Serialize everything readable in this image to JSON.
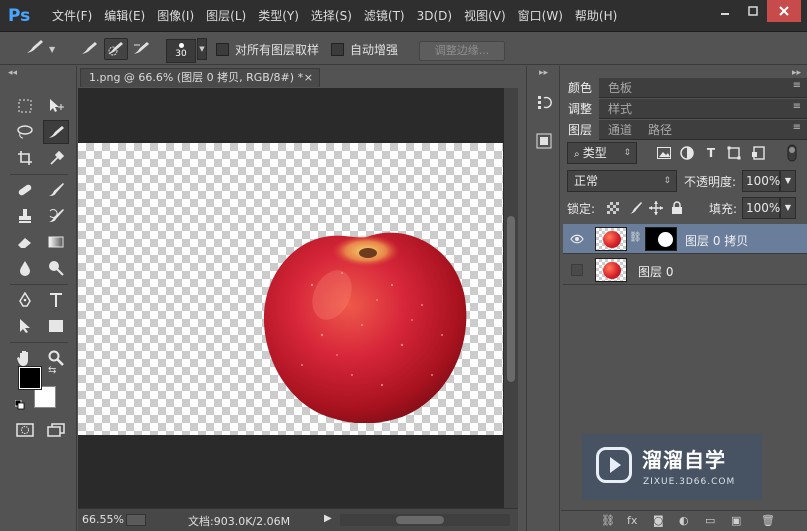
{
  "app": {
    "logo": "Ps",
    "menu": [
      "文件(F)",
      "编辑(E)",
      "图像(I)",
      "图层(L)",
      "类型(Y)",
      "选择(S)",
      "滤镜(T)",
      "3D(D)",
      "视图(V)",
      "窗口(W)",
      "帮助(H)"
    ],
    "window_controls": [
      "minimize-icon",
      "maximize-icon",
      "close-icon"
    ]
  },
  "options_bar": {
    "tool_icon": "quick-selection-brush-icon",
    "brush_size": "30",
    "sample_all_layers_label": "对所有图层取样",
    "sample_all_layers_checked": false,
    "auto_enhance_label": "自动增强",
    "auto_enhance_checked": false,
    "refine_edge_label": "调整边缘..."
  },
  "document": {
    "tab_title": "1.png @ 66.6% (图层 0 拷贝, RGB/8#) *",
    "tab_close": "×",
    "zoom": "66.55%",
    "doc_size": "文档:903.0K/2.06M",
    "status_arrow": "▶"
  },
  "colors": {
    "foreground": "#000000",
    "background": "#ffffff",
    "selected_layer": "#6a7d9a"
  },
  "panels": {
    "group1_tabs": [
      "颜色",
      "色板"
    ],
    "group2_tabs": [
      "调整",
      "样式"
    ],
    "group3_tabs": [
      "图层",
      "通道",
      "路径"
    ],
    "filter_kind": "类型",
    "blend_mode": "正常",
    "opacity_label": "不透明度:",
    "opacity_value": "100%",
    "lock_label": "锁定:",
    "fill_label": "填充:",
    "fill_value": "100%",
    "layers": [
      {
        "name": "图层 0 拷贝",
        "visible": true,
        "selected": true,
        "has_mask": true
      },
      {
        "name": "图层 0",
        "visible": false,
        "selected": false,
        "has_mask": false
      }
    ]
  },
  "watermark": {
    "title": "溜溜自学",
    "subtitle": "ZIXUE.3D66.COM"
  }
}
